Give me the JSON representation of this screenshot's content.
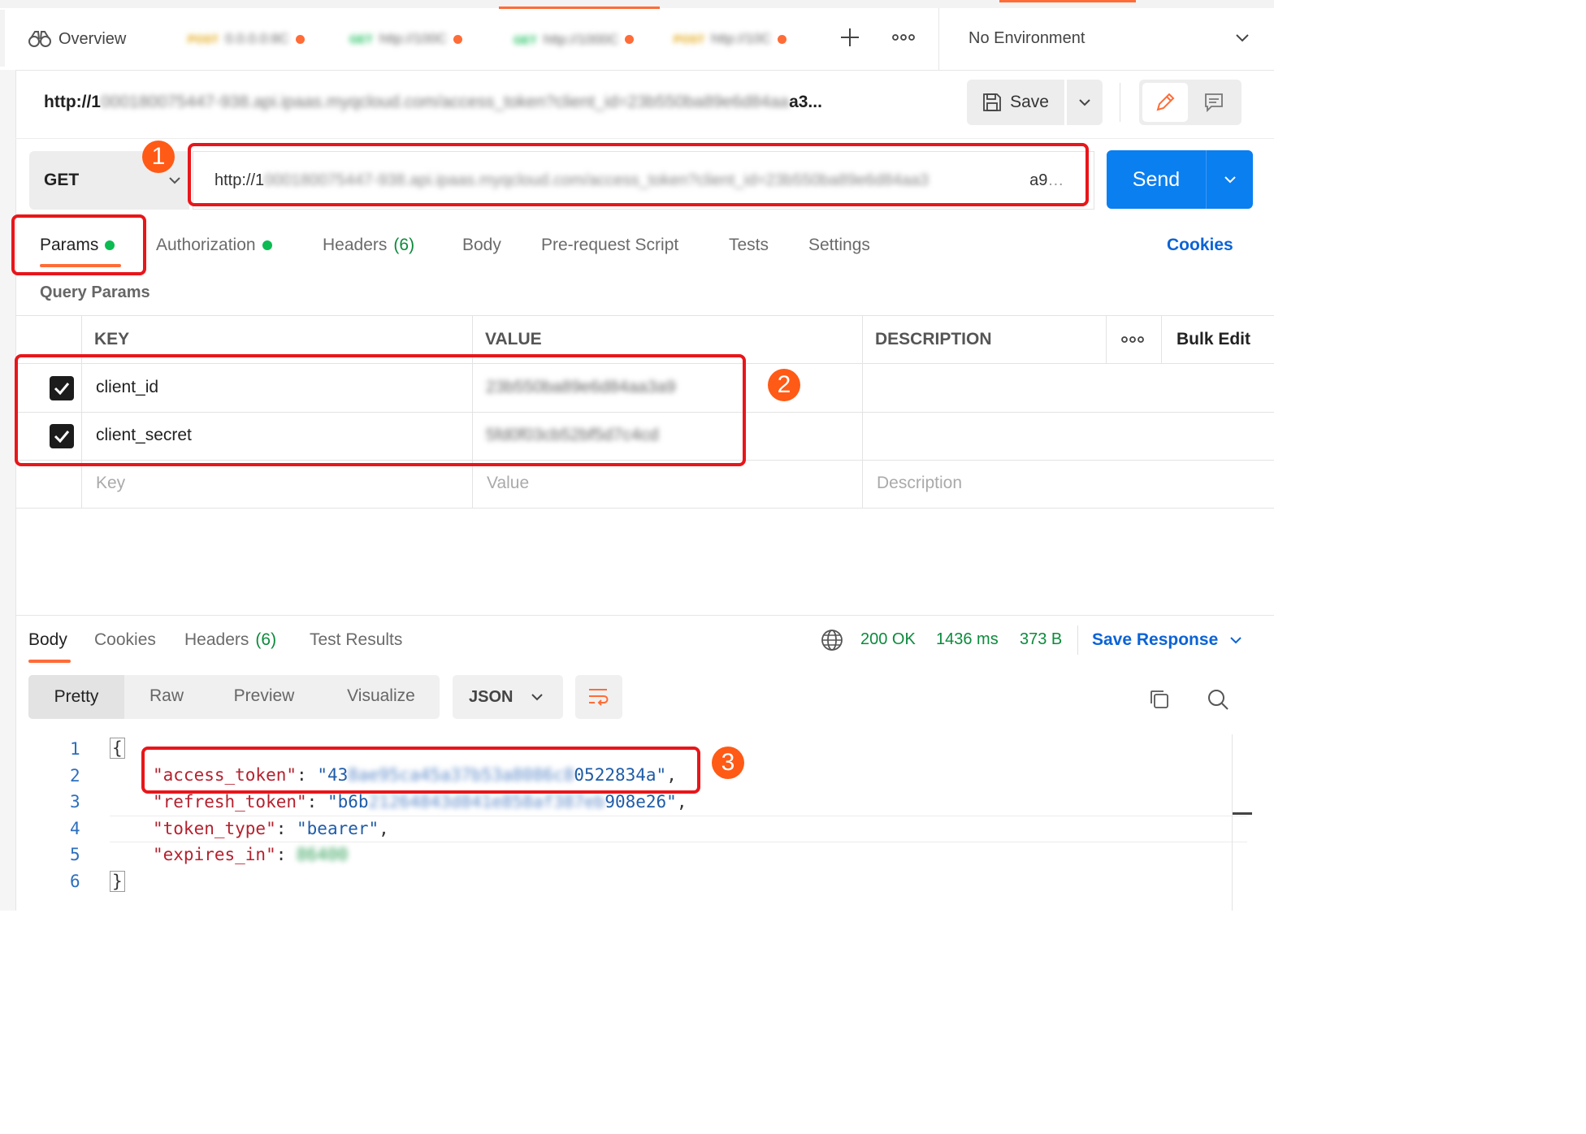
{
  "tabs": {
    "overview_label": "Overview",
    "items": [
      {
        "method": "POST",
        "url": "0.0.0.0:8C"
      },
      {
        "method": "GET",
        "url": "http://100C"
      },
      {
        "method": "GET",
        "url": "http://1000C"
      },
      {
        "method": "POST",
        "url": "http://10C"
      }
    ]
  },
  "environment": {
    "label": "No Environment"
  },
  "request_title": {
    "prefix": "http://1",
    "hidden": "000180075447-938.api.ipaas.myqcloud.com/access_token?client_id=23b550ba89e6d84aa",
    "suffix": "a3..."
  },
  "toolbar": {
    "save_label": "Save"
  },
  "url_bar": {
    "method": "GET",
    "url_prefix": "http://1",
    "url_hidden": "000180075447-938.api.ipaas.myqcloud.com/access_token?client_id=23b550ba89e6d84aa3",
    "url_suffix": "a9",
    "url_ellipsis": "…",
    "send_label": "Send"
  },
  "request_tabs": [
    {
      "label": "Params",
      "dot": true
    },
    {
      "label": "Authorization",
      "dot": true
    },
    {
      "label": "Headers",
      "count": "(6)"
    },
    {
      "label": "Body"
    },
    {
      "label": "Pre-request Script"
    },
    {
      "label": "Tests"
    },
    {
      "label": "Settings"
    }
  ],
  "cookies_link": "Cookies",
  "query_params": {
    "title": "Query Params",
    "columns": {
      "key": "KEY",
      "value": "VALUE",
      "description": "DESCRIPTION",
      "bulk_edit": "Bulk Edit"
    },
    "rows": [
      {
        "checked": true,
        "key": "client_id",
        "value": "23b550ba89e6d84aa3a9"
      },
      {
        "checked": true,
        "key": "client_secret",
        "value": "5fd0f03cb52bf5d7c4cd"
      }
    ],
    "placeholders": {
      "key": "Key",
      "value": "Value",
      "description": "Description"
    }
  },
  "response": {
    "tabs": [
      {
        "label": "Body"
      },
      {
        "label": "Cookies"
      },
      {
        "label": "Headers",
        "count": "(6)"
      },
      {
        "label": "Test Results"
      }
    ],
    "status": "200 OK",
    "time": "1436 ms",
    "size": "373 B",
    "save_response": "Save Response",
    "view_modes": [
      "Pretty",
      "Raw",
      "Preview",
      "Visualize"
    ],
    "format": "JSON",
    "code": {
      "line_numbers": [
        "1",
        "2",
        "3",
        "4",
        "5",
        "6"
      ],
      "open_brace": "{",
      "close_brace": "}",
      "access_token_key": "\"access_token\"",
      "access_token_visible_start": "\"43",
      "access_token_hidden": "8ae95ca45a37b53a8086c8",
      "access_token_visible_end": "0522834a\"",
      "refresh_token_key": "\"refresh_token\"",
      "refresh_token_visible_start": "\"b6b",
      "refresh_token_hidden": "21264843d841e858af387eb",
      "refresh_token_visible_end": "908e26\"",
      "token_type_key": "\"token_type\"",
      "token_type_value": "\"bearer\"",
      "expires_in_key": "\"expires_in\"",
      "expires_in_hidden": "86400"
    }
  },
  "annotations": [
    "1",
    "2",
    "3"
  ],
  "colors": {
    "accent": "#ff6c37",
    "send": "#0a7ff0",
    "link": "#0b63d6",
    "status_ok": "#0c8a3c",
    "highlight": "#e8161a"
  }
}
